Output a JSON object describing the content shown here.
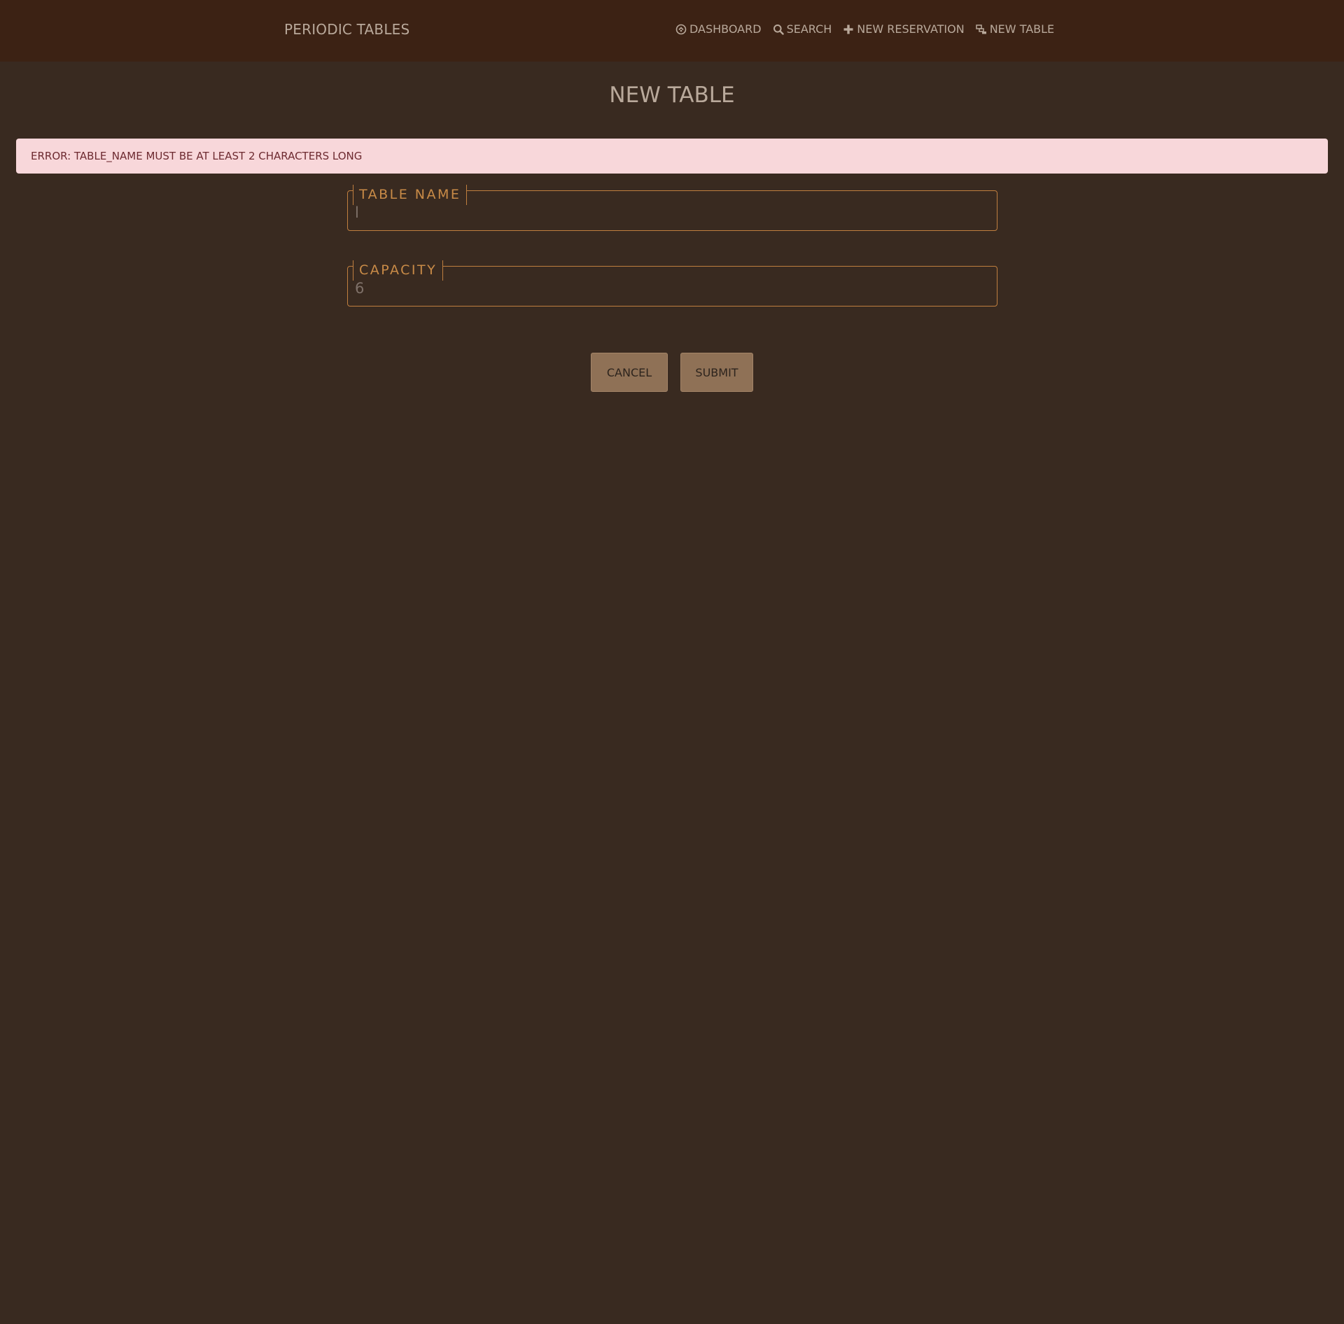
{
  "header": {
    "brand": "PERIODIC TABLES",
    "nav": [
      {
        "label": "DASHBOARD",
        "icon": "dashboard-gauge-icon"
      },
      {
        "label": "SEARCH",
        "icon": "search-icon"
      },
      {
        "label": "NEW RESERVATION",
        "icon": "plus-icon"
      },
      {
        "label": "NEW TABLE",
        "icon": "table-layers-icon"
      }
    ]
  },
  "page": {
    "title": "NEW TABLE"
  },
  "error": {
    "message": "ERROR: TABLE_NAME MUST BE AT LEAST 2 CHARACTERS LONG"
  },
  "form": {
    "table_name": {
      "label": "TABLE NAME",
      "value": "l"
    },
    "capacity": {
      "label": "CAPACITY",
      "value": "6"
    },
    "cancel_label": "CANCEL",
    "submit_label": "SUBMIT"
  },
  "colors": {
    "background": "#392a20",
    "topbar": "#3c2214",
    "accent": "#c07f3f",
    "error_bg": "#f8d7da",
    "button_bg": "#8f7156"
  }
}
